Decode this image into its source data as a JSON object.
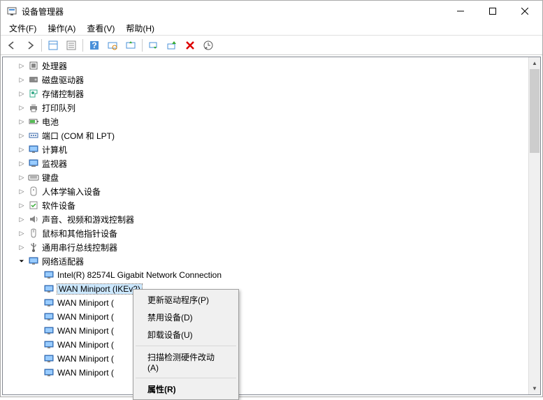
{
  "window": {
    "title": "设备管理器"
  },
  "menu": {
    "file": "文件(F)",
    "action": "操作(A)",
    "view": "查看(V)",
    "help": "帮助(H)"
  },
  "categories": [
    {
      "name": "处理器",
      "icon": "cpu"
    },
    {
      "name": "磁盘驱动器",
      "icon": "disk"
    },
    {
      "name": "存储控制器",
      "icon": "storage"
    },
    {
      "name": "打印队列",
      "icon": "printer"
    },
    {
      "name": "电池",
      "icon": "battery"
    },
    {
      "name": "端口 (COM 和 LPT)",
      "icon": "port"
    },
    {
      "name": "计算机",
      "icon": "computer"
    },
    {
      "name": "监视器",
      "icon": "monitor"
    },
    {
      "name": "键盘",
      "icon": "keyboard"
    },
    {
      "name": "人体学输入设备",
      "icon": "hid"
    },
    {
      "name": "软件设备",
      "icon": "software"
    },
    {
      "name": "声音、视频和游戏控制器",
      "icon": "audio"
    },
    {
      "name": "鼠标和其他指针设备",
      "icon": "mouse"
    },
    {
      "name": "通用串行总线控制器",
      "icon": "usb"
    }
  ],
  "network": {
    "category": "网络适配器",
    "items": [
      "Intel(R) 82574L Gigabit Network Connection",
      "WAN Miniport (IKEv2)",
      "WAN Miniport (",
      "WAN Miniport (",
      "WAN Miniport (",
      "WAN Miniport (",
      "WAN Miniport (",
      "WAN Miniport ("
    ],
    "selected_index": 1
  },
  "context_menu": {
    "update": "更新驱动程序(P)",
    "disable": "禁用设备(D)",
    "uninstall": "卸载设备(U)",
    "scan": "扫描检测硬件改动(A)",
    "properties": "属性(R)"
  }
}
